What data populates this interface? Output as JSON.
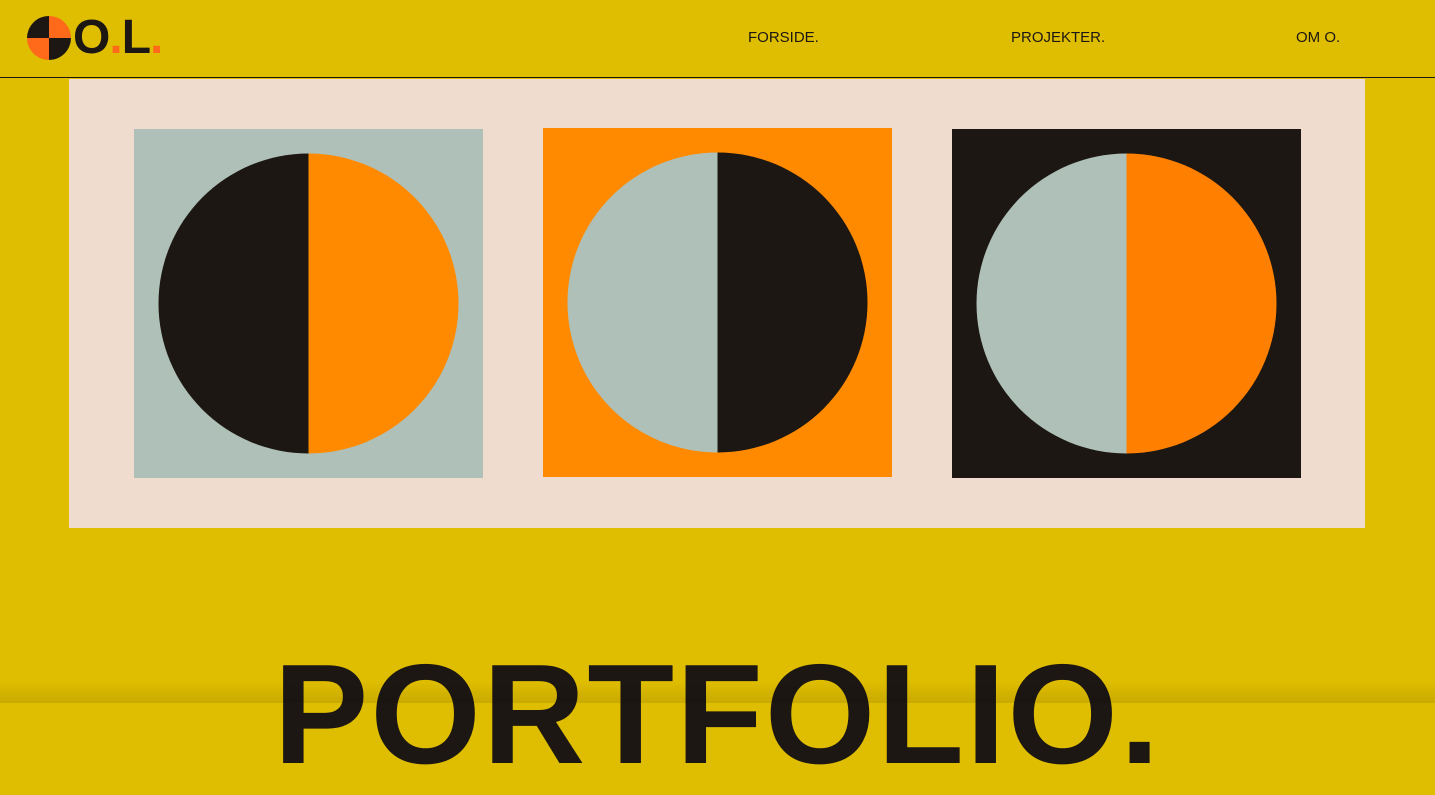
{
  "brand": {
    "letter1": "O",
    "dot1": ".",
    "letter2": "L",
    "dot2": ".",
    "mark_icon": "quartered-circle-icon"
  },
  "nav": {
    "items": [
      {
        "label": "FORSIDE."
      },
      {
        "label": "PROJEKTER."
      },
      {
        "label": "OM O."
      }
    ]
  },
  "gallery": {
    "tiles": [
      {
        "name": "tile-1",
        "background": "#aec0b7",
        "left_half": "#1c1712",
        "right_half": "#ff8a00"
      },
      {
        "name": "tile-2",
        "background": "#ff8a00",
        "left_half": "#aec0b7",
        "right_half": "#1c1712"
      },
      {
        "name": "tile-3",
        "background": "#1c1712",
        "left_half": "#aec0b7",
        "right_half": "#ff8000"
      }
    ]
  },
  "hero": {
    "headline": "PORTFOLIO."
  },
  "colors": {
    "page_background": "#dfbd00",
    "panel_background": "#efdccf",
    "ink": "#1c1712",
    "orange": "#ff8a00",
    "sage": "#aec0b7",
    "logo_dot": "#ff6a1a"
  }
}
